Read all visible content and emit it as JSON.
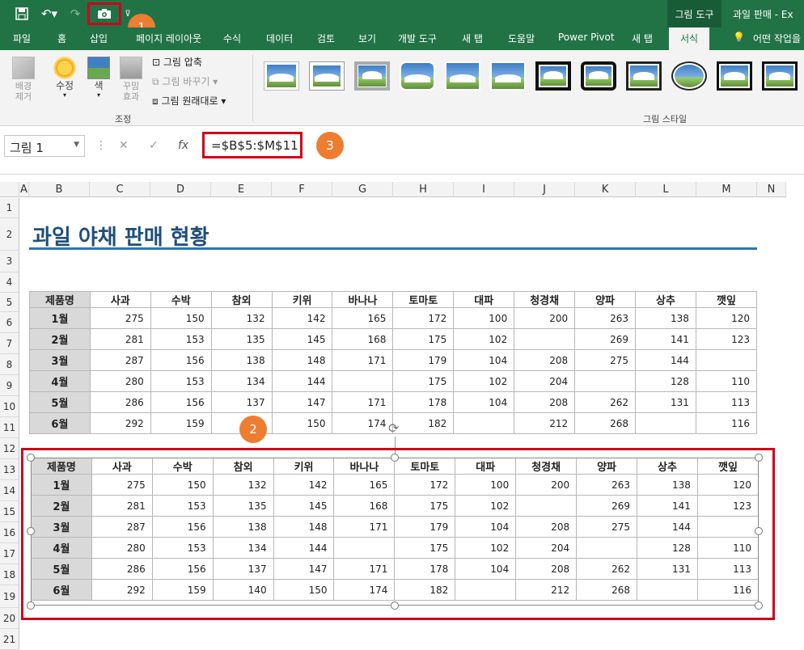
{
  "qat": {
    "save_icon": "save-icon",
    "undo_icon": "undo-icon",
    "redo_icon": "redo-icon",
    "camera_icon": "camera-icon"
  },
  "window": {
    "context_tab": "그림 도구",
    "title": "과일 판매 - Ex"
  },
  "tabs": [
    "파일",
    "홈",
    "삽입",
    "페이지 레이아웃",
    "수식",
    "데이터",
    "검토",
    "보기",
    "개발 도구",
    "새 탭",
    "도움말",
    "Power Pivot",
    "새 탭",
    "서식"
  ],
  "tell_me": "어떤 작업을",
  "ribbon": {
    "remove_bg": "배경\n제거",
    "corrections": "수정",
    "color": "색",
    "artistic": "꾸밈\n효과",
    "compress": "그림 압축",
    "change": "그림 바꾸기",
    "reset": "그림 원래대로",
    "adjust_group": "조정",
    "styles_group": "그림 스타일"
  },
  "namebox": "그림 1",
  "formula": "=$B$5:$M$11",
  "badges": [
    "1",
    "2",
    "3"
  ],
  "columns": [
    "A",
    "B",
    "C",
    "D",
    "E",
    "F",
    "G",
    "H",
    "I",
    "J",
    "K",
    "L",
    "M",
    "N"
  ],
  "rows": [
    "1",
    "2",
    "3",
    "4",
    "5",
    "6",
    "7",
    "8",
    "9",
    "10",
    "11",
    "12",
    "13",
    "14",
    "15",
    "16",
    "17",
    "18",
    "19",
    "20",
    "21"
  ],
  "sheet_title": "과일 야채 판매 현황",
  "table": {
    "headers": [
      "제품명",
      "사과",
      "수박",
      "참외",
      "키위",
      "바나나",
      "토마토",
      "대파",
      "청경채",
      "양파",
      "상추",
      "깻잎"
    ],
    "rows": [
      [
        "1월",
        "275",
        "150",
        "132",
        "142",
        "165",
        "172",
        "100",
        "200",
        "263",
        "138",
        "120"
      ],
      [
        "2월",
        "281",
        "153",
        "135",
        "145",
        "168",
        "175",
        "102",
        "",
        "269",
        "141",
        "123"
      ],
      [
        "3월",
        "287",
        "156",
        "138",
        "148",
        "171",
        "179",
        "104",
        "208",
        "275",
        "144",
        ""
      ],
      [
        "4월",
        "280",
        "153",
        "134",
        "144",
        "",
        "175",
        "102",
        "204",
        "",
        "128",
        "110"
      ],
      [
        "5월",
        "286",
        "156",
        "137",
        "147",
        "171",
        "178",
        "104",
        "208",
        "262",
        "131",
        "113"
      ],
      [
        "6월",
        "292",
        "159",
        "140",
        "150",
        "174",
        "182",
        "",
        "212",
        "268",
        "",
        "116"
      ]
    ]
  },
  "picture_table": {
    "headers": [
      "제품명",
      "사과",
      "수박",
      "참외",
      "키위",
      "바나나",
      "토마토",
      "대파",
      "청경채",
      "양파",
      "상추",
      "깻잎"
    ],
    "rows": [
      [
        "1월",
        "275",
        "150",
        "132",
        "142",
        "165",
        "172",
        "100",
        "200",
        "263",
        "138",
        "120"
      ],
      [
        "2월",
        "281",
        "153",
        "135",
        "145",
        "168",
        "175",
        "102",
        "",
        "269",
        "141",
        "123"
      ],
      [
        "3월",
        "287",
        "156",
        "138",
        "148",
        "171",
        "179",
        "104",
        "208",
        "275",
        "144",
        ""
      ],
      [
        "4월",
        "280",
        "153",
        "134",
        "144",
        "",
        "175",
        "102",
        "204",
        "",
        "128",
        "110"
      ],
      [
        "5월",
        "286",
        "156",
        "137",
        "147",
        "171",
        "178",
        "104",
        "208",
        "262",
        "131",
        "113"
      ],
      [
        "6월",
        "292",
        "159",
        "140",
        "150",
        "174",
        "182",
        "",
        "212",
        "268",
        "",
        "116"
      ]
    ]
  }
}
